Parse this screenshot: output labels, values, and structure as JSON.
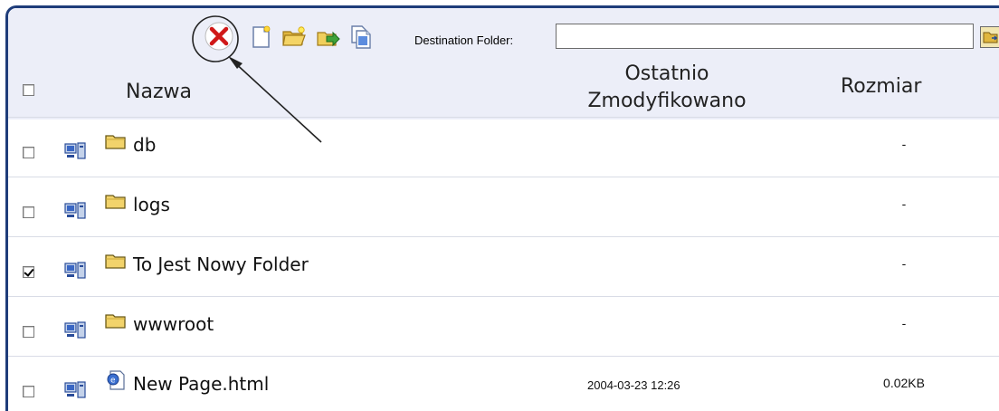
{
  "toolbar": {
    "destination_label": "Destination Folder:",
    "destination_value": "",
    "icons": [
      "delete-icon",
      "new-file-icon",
      "new-folder-icon",
      "move-icon",
      "copy-icon"
    ]
  },
  "columns": {
    "name": "Nazwa",
    "modified_line1": "Ostatnio",
    "modified_line2": "Zmodyfikowano",
    "size": "Rozmiar"
  },
  "rows": [
    {
      "name": "db",
      "type": "folder",
      "modified": "",
      "size": "-",
      "checked": false
    },
    {
      "name": "logs",
      "type": "folder",
      "modified": "",
      "size": "-",
      "checked": false
    },
    {
      "name": "To Jest Nowy Folder",
      "type": "folder",
      "modified": "",
      "size": "-",
      "checked": true
    },
    {
      "name": "wwwroot",
      "type": "folder",
      "modified": "",
      "size": "-",
      "checked": false
    },
    {
      "name": "New Page.html",
      "type": "html-file",
      "modified": "2004-03-23 12:26",
      "size": "0.02KB",
      "checked": false
    }
  ],
  "colors": {
    "header_bg": "#eceef8",
    "frame_border": "#1f3d7a",
    "row_divider": "#d9dce6",
    "folder": "#f2d36b"
  }
}
